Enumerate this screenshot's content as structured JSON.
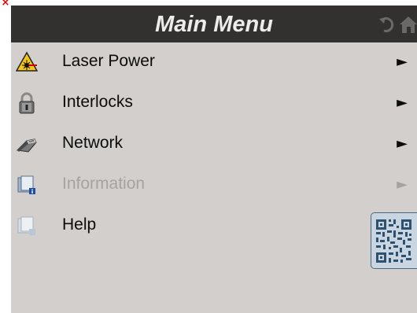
{
  "header": {
    "close_glyph": "×",
    "title": "Main Menu",
    "back_icon": "back-arrow-icon",
    "home_icon": "home-icon"
  },
  "menu": {
    "items": [
      {
        "label": "Laser Power",
        "icon": "laser-warning-icon",
        "arrow": "►",
        "enabled": true
      },
      {
        "label": "Interlocks",
        "icon": "padlock-icon",
        "arrow": "►",
        "enabled": true
      },
      {
        "label": "Network",
        "icon": "network-cable-icon",
        "arrow": "►",
        "enabled": true
      },
      {
        "label": "Information",
        "icon": "information-document-icon",
        "arrow": "►",
        "enabled": false
      },
      {
        "label": "Help",
        "icon": "help-document-icon",
        "arrow": "",
        "enabled": true
      }
    ]
  },
  "qr": {
    "icon": "qr-code-icon"
  },
  "colors": {
    "titlebar": "#333130",
    "panel": "#d3cfcc",
    "text": "#0c0c0c",
    "disabled_text": "#a6a2a0",
    "close": "#e00000"
  }
}
